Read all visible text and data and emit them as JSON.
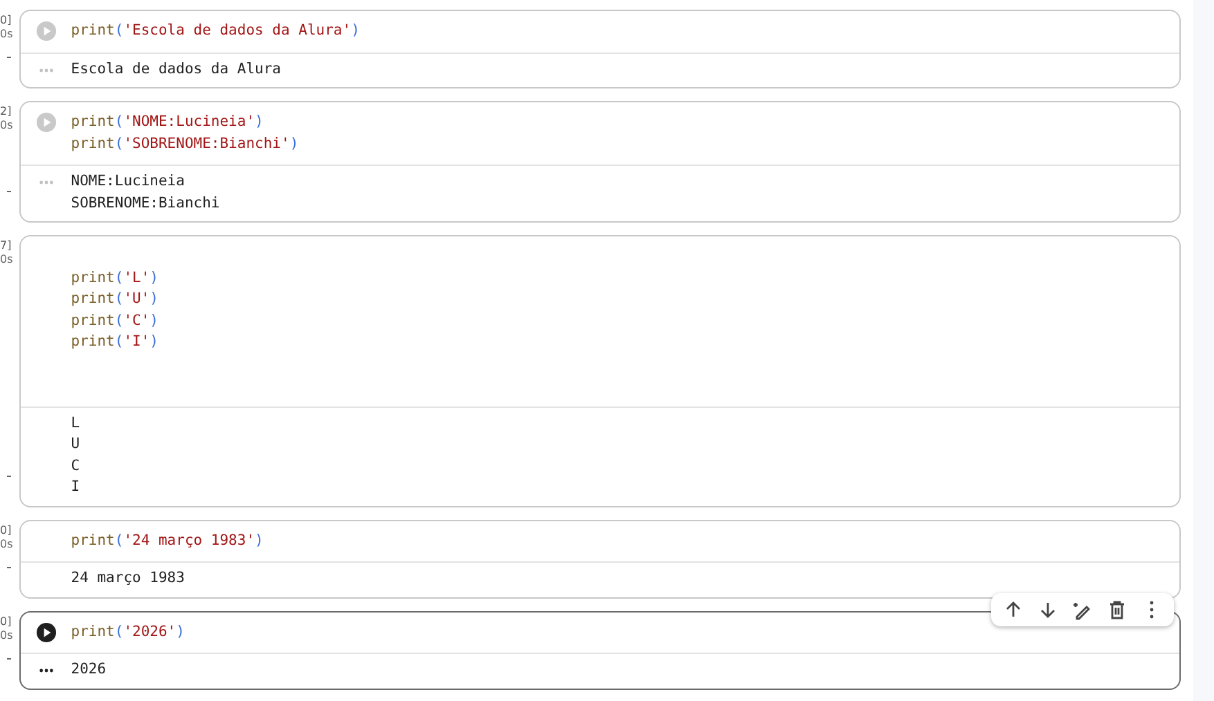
{
  "cells": [
    {
      "execution_count": "0]",
      "duration": "0s",
      "selected": false,
      "run_button_visible": true,
      "code": "print('Escola de dados da Alura')",
      "output": "Escola de dados da Alura"
    },
    {
      "execution_count": "2]",
      "duration": "0s",
      "selected": false,
      "run_button_visible": true,
      "code": "print('NOME:Lucineia')\nprint('SOBRENOME:Bianchi')",
      "output": "NOME:Lucineia\nSOBRENOME:Bianchi"
    },
    {
      "execution_count": "7]",
      "duration": "0s",
      "selected": false,
      "run_button_visible": false,
      "code": "\nprint('L')\nprint('U')\nprint('C')\nprint('I')\n\n\n",
      "output": "L\nU\nC\nI"
    },
    {
      "execution_count": "0]",
      "duration": "0s",
      "selected": false,
      "run_button_visible": false,
      "code": "print('24 março 1983')",
      "output": "24 março 1983"
    },
    {
      "execution_count": "0]",
      "duration": "0s",
      "selected": true,
      "run_button_visible": true,
      "code": "print('2026')",
      "output": "2026"
    }
  ]
}
